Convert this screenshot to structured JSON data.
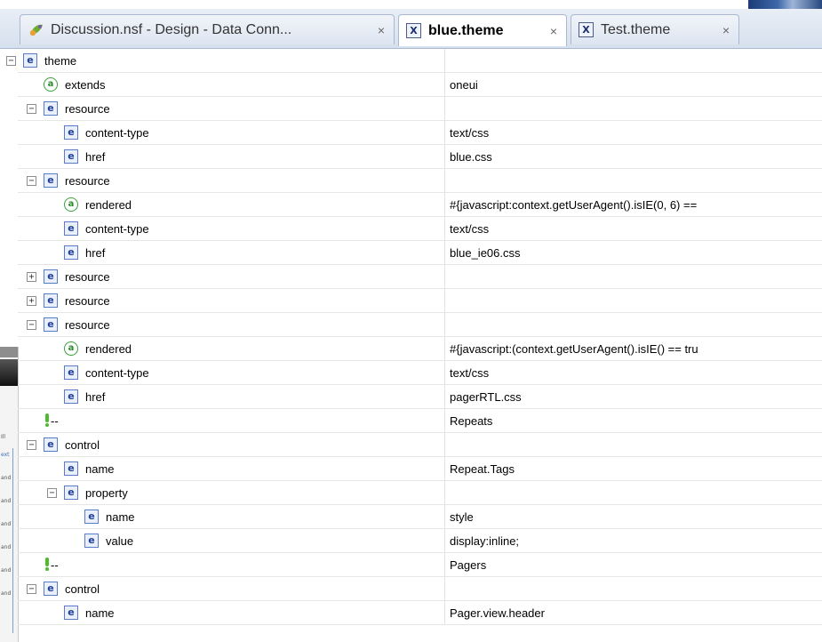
{
  "tabs": [
    {
      "label": "Discussion.nsf - Design - Data Conn...",
      "icon": "design-leaf-icon",
      "active": false
    },
    {
      "label": "blue.theme",
      "icon": "xml-file-icon",
      "active": true
    },
    {
      "label": "Test.theme",
      "icon": "xml-file-icon",
      "active": false
    }
  ],
  "close_glyph": "×",
  "tree": [
    {
      "depth": 0,
      "toggle": "minus",
      "type": "element",
      "name": "theme",
      "value": ""
    },
    {
      "depth": 1,
      "toggle": "",
      "type": "attribute",
      "name": "extends",
      "value": "oneui"
    },
    {
      "depth": 1,
      "toggle": "minus",
      "type": "element",
      "name": "resource",
      "value": ""
    },
    {
      "depth": 2,
      "toggle": "",
      "type": "element",
      "name": "content-type",
      "value": "text/css"
    },
    {
      "depth": 2,
      "toggle": "",
      "type": "element",
      "name": "href",
      "value": "blue.css"
    },
    {
      "depth": 1,
      "toggle": "minus",
      "type": "element",
      "name": "resource",
      "value": ""
    },
    {
      "depth": 2,
      "toggle": "",
      "type": "attribute",
      "name": "rendered",
      "value": "#{javascript:context.getUserAgent().isIE(0, 6) =="
    },
    {
      "depth": 2,
      "toggle": "",
      "type": "element",
      "name": "content-type",
      "value": "text/css"
    },
    {
      "depth": 2,
      "toggle": "",
      "type": "element",
      "name": "href",
      "value": "blue_ie06.css"
    },
    {
      "depth": 1,
      "toggle": "plus",
      "type": "element",
      "name": "resource",
      "value": ""
    },
    {
      "depth": 1,
      "toggle": "plus",
      "type": "element",
      "name": "resource",
      "value": ""
    },
    {
      "depth": 1,
      "toggle": "minus",
      "type": "element",
      "name": "resource",
      "value": ""
    },
    {
      "depth": 2,
      "toggle": "",
      "type": "attribute",
      "name": "rendered",
      "value": "#{javascript:(context.getUserAgent().isIE() == tru"
    },
    {
      "depth": 2,
      "toggle": "",
      "type": "element",
      "name": "content-type",
      "value": "text/css"
    },
    {
      "depth": 2,
      "toggle": "",
      "type": "element",
      "name": "href",
      "value": "pagerRTL.css"
    },
    {
      "depth": 1,
      "toggle": "",
      "type": "comment",
      "name": "--",
      "value": "Repeats"
    },
    {
      "depth": 1,
      "toggle": "minus",
      "type": "element",
      "name": "control",
      "value": ""
    },
    {
      "depth": 2,
      "toggle": "",
      "type": "element",
      "name": "name",
      "value": "Repeat.Tags"
    },
    {
      "depth": 2,
      "toggle": "minus",
      "type": "element",
      "name": "property",
      "value": ""
    },
    {
      "depth": 3,
      "toggle": "",
      "type": "element",
      "name": "name",
      "value": "style"
    },
    {
      "depth": 3,
      "toggle": "",
      "type": "element",
      "name": "value",
      "value": "display:inline;"
    },
    {
      "depth": 1,
      "toggle": "",
      "type": "comment",
      "name": "--",
      "value": "Pagers"
    },
    {
      "depth": 1,
      "toggle": "minus",
      "type": "element",
      "name": "control",
      "value": ""
    },
    {
      "depth": 2,
      "toggle": "",
      "type": "element",
      "name": "name",
      "value": "Pager.view.header"
    }
  ],
  "glyphs": {
    "element": "e",
    "attribute": "a",
    "minus": "−",
    "plus": "+"
  },
  "background_fragments": [
    "Ill",
    "ext",
    "and",
    "and",
    "and",
    "and",
    "and",
    "and"
  ],
  "colors": {
    "tab_bar": "#dde5f1",
    "element_icon": "#1e3f93",
    "attribute_icon": "#2a8a2a",
    "comment_icon": "#4dbb2c"
  }
}
